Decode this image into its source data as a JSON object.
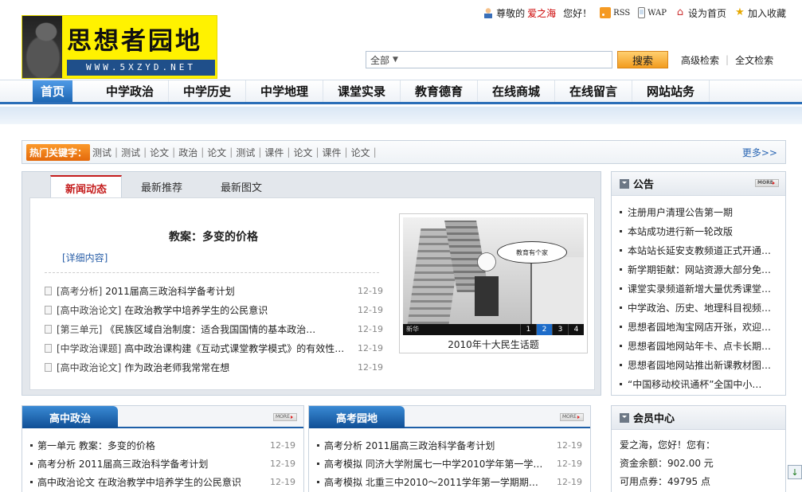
{
  "topbar": {
    "greeting_prefix": "尊敬的",
    "username": "爱之海",
    "greeting_suffix": "您好！",
    "rss": "RSS",
    "wap": "WAP",
    "set_home": "设为首页",
    "bookmark": "加入收藏"
  },
  "logo": {
    "title": "思想者园地",
    "url": "WWW.5XZYD.NET"
  },
  "search": {
    "scope": "全部",
    "query": "",
    "button": "搜索",
    "advanced": "高级检索",
    "fulltext": "全文检索"
  },
  "nav": {
    "items": [
      {
        "label": "首页"
      },
      {
        "label": "中学政治"
      },
      {
        "label": "中学历史"
      },
      {
        "label": "中学地理"
      },
      {
        "label": "课堂实录"
      },
      {
        "label": "教育德育"
      },
      {
        "label": "在线商城"
      },
      {
        "label": "在线留言"
      },
      {
        "label": "网站站务"
      }
    ]
  },
  "hot": {
    "label": "热门关键字：",
    "keywords": [
      "测试",
      "测试",
      "论文",
      "政治",
      "论文",
      "测试",
      "课件",
      "论文",
      "课件",
      "论文"
    ],
    "more": "更多>>"
  },
  "news": {
    "tabs": [
      {
        "label": "新闻动态"
      },
      {
        "label": "最新推荐"
      },
      {
        "label": "最新图文"
      }
    ],
    "feature_title": "教案：多变的价格",
    "detail": "[详细内容]",
    "items": [
      {
        "cat": "[高考分析]",
        "title": "2011届高三政治科学备考计划",
        "date": "12-19"
      },
      {
        "cat": "[高中政治论文]",
        "title": "在政治教学中培养学生的公民意识",
        "date": "12-19"
      },
      {
        "cat": "[第三单元]",
        "title": "《民族区域自治制度：适合我国国情的基本政治…",
        "date": "12-19"
      },
      {
        "cat": "[中学政治课题]",
        "title": "高中政治课构建《互动式课堂教学模式》的有效性…",
        "date": "12-19"
      },
      {
        "cat": "[高中政治论文]",
        "title": "作为政治老师我常常在想",
        "date": "12-19"
      }
    ],
    "slide": {
      "caption": "2010年十大民生话题",
      "bubble": "教育有个家",
      "credit": "新华",
      "pages": [
        "1",
        "2",
        "3",
        "4"
      ],
      "active_page": "2"
    }
  },
  "notice": {
    "title": "公告",
    "more": "MORE",
    "items": [
      "注册用户清理公告第一期",
      "本站成功进行新一轮改版",
      "本站站长延安支教频道正式开通…",
      "新学期钜献：网站资源大部分免…",
      "课堂实录频道新增大量优秀课堂…",
      "中学政治、历史、地理科目视频…",
      "思想者园地淘宝网店开张，欢迎…",
      "思想者园地网站年卡、点卡长期…",
      "思想者园地网站推出新课教材图…",
      "“中国移动校讯通杯”全国中小…"
    ]
  },
  "member": {
    "title": "会员中心",
    "greeting": "爱之海，您好！您有：",
    "balance": "资金余额：902.00 元",
    "points": "可用点券：49795 点"
  },
  "col_politics": {
    "title": "高中政治",
    "more": "MORE",
    "items": [
      {
        "title": "第一单元 教案：多变的价格",
        "date": "12-19"
      },
      {
        "title": "高考分析 2011届高三政治科学备考计划",
        "date": "12-19"
      },
      {
        "title": "高中政治论文 在政治教学中培养学生的公民意识",
        "date": "12-19"
      }
    ]
  },
  "col_gaokao": {
    "title": "高考园地",
    "more": "MORE",
    "items": [
      {
        "title": "高考分析 2011届高三政治科学备考计划",
        "date": "12-19"
      },
      {
        "title": "高考模拟 同济大学附属七一中学2010学年第一学期高…",
        "date": "12-19"
      },
      {
        "title": "高考模拟 北重三中2010～2011学年第一学期期中考试…",
        "date": "12-19"
      }
    ]
  }
}
